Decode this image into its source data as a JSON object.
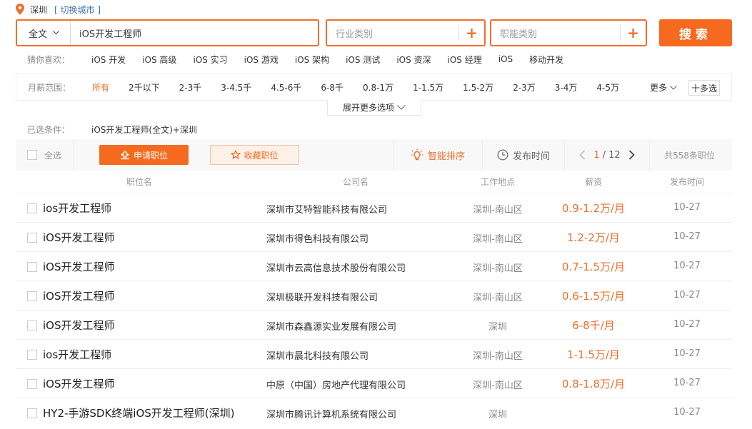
{
  "location": {
    "city": "深圳",
    "switch_label": "[ 切换城市 ]"
  },
  "search": {
    "scope": "全文",
    "keyword": "iOS开发工程师",
    "industry_placeholder": "行业类别",
    "function_placeholder": "职能类别",
    "plus": "+",
    "button": "搜索"
  },
  "guess": {
    "label": "猜你喜欢：",
    "tags": [
      "iOS 开发",
      "iOS 高级",
      "iOS 实习",
      "iOS 游戏",
      "iOS 架构",
      "iOS 测试",
      "iOS 资深",
      "iOS 经理",
      "iOS",
      "移动开发"
    ]
  },
  "salary_filter": {
    "label": "月薪范围：",
    "options": [
      "所有",
      "2千以下",
      "2-3千",
      "3-4.5千",
      "4.5-6千",
      "6-8千",
      "0.8-1万",
      "1-1.5万",
      "1.5-2万",
      "2-3万",
      "3-4万",
      "4-5万"
    ],
    "more": "更多",
    "multi": "十多选"
  },
  "expand_label": "展开更多选项",
  "selected": {
    "label": "已选条件：",
    "value": "iOS开发工程师(全文)+深圳"
  },
  "toolbar": {
    "select_all": "全选",
    "apply": "申请职位",
    "favorite": "收藏职位",
    "smart_sort": "智能排序",
    "time_sort": "发布时间",
    "page_current": "1",
    "page_total": "/ 12",
    "total": "共558条职位"
  },
  "table": {
    "headers": {
      "title": "职位名",
      "company": "公司名",
      "place": "工作地点",
      "salary": "薪资",
      "date": "发布时间"
    },
    "rows": [
      {
        "title": "ios开发工程师",
        "company": "深圳市艾特智能科技有限公司",
        "place": "深圳-南山区",
        "salary": "0.9-1.2万/月",
        "date": "10-27"
      },
      {
        "title": "iOS开发工程师",
        "company": "深圳市得色科技有限公司",
        "place": "深圳-南山区",
        "salary": "1.2-2万/月",
        "date": "10-27"
      },
      {
        "title": "iOS开发工程师",
        "company": "深圳市云高信息技术股份有限公司",
        "place": "深圳-南山区",
        "salary": "0.7-1.5万/月",
        "date": "10-27"
      },
      {
        "title": "iOS开发工程师",
        "company": "深圳极联开发科技有限公司",
        "place": "深圳-南山区",
        "salary": "0.6-1.5万/月",
        "date": "10-27"
      },
      {
        "title": "iOS开发工程师",
        "company": "深圳市森鑫源实业发展有限公司",
        "place": "深圳",
        "salary": "6-8千/月",
        "date": "10-27"
      },
      {
        "title": "ios开发工程师",
        "company": "深圳市晨北科技有限公司",
        "place": "深圳-南山区",
        "salary": "1-1.5万/月",
        "date": "10-27"
      },
      {
        "title": "iOS开发工程师",
        "company": "中原（中国）房地产代理有限公司",
        "place": "深圳-南山区",
        "salary": "0.8-1.8万/月",
        "date": "10-27"
      },
      {
        "title": "HY2-手游SDK终端iOS开发工程师(深圳)",
        "company": "深圳市腾讯计算机系统有限公司",
        "place": "深圳",
        "salary": "",
        "date": "10-27"
      }
    ]
  },
  "colors": {
    "accent": "#f06e2a",
    "button": "#f56a1e"
  }
}
